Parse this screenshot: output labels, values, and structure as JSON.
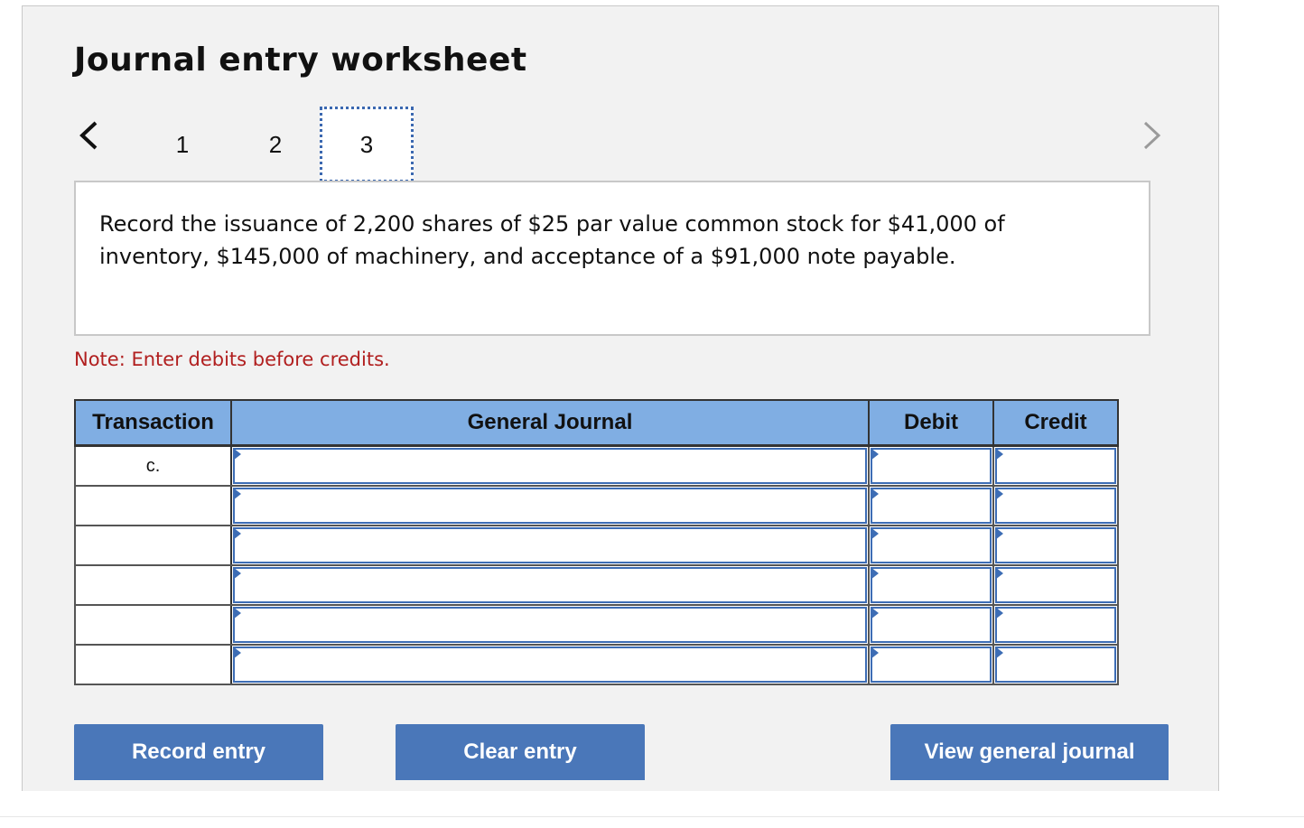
{
  "worksheet": {
    "title": "Journal entry worksheet",
    "steps": [
      "1",
      "2",
      "3"
    ],
    "active_step": "3",
    "prompt": "Record the issuance of 2,200 shares of $25 par value common stock for $41,000 of inventory, $145,000 of machinery, and acceptance of a $91,000 note payable.",
    "note": "Note: Enter debits before credits."
  },
  "table": {
    "headers": [
      "Transaction",
      "General Journal",
      "Debit",
      "Credit"
    ],
    "rows": [
      {
        "transaction": "c.",
        "account": "",
        "debit": "",
        "credit": ""
      },
      {
        "transaction": "",
        "account": "",
        "debit": "",
        "credit": ""
      },
      {
        "transaction": "",
        "account": "",
        "debit": "",
        "credit": ""
      },
      {
        "transaction": "",
        "account": "",
        "debit": "",
        "credit": ""
      },
      {
        "transaction": "",
        "account": "",
        "debit": "",
        "credit": ""
      },
      {
        "transaction": "",
        "account": "",
        "debit": "",
        "credit": ""
      }
    ]
  },
  "buttons": {
    "record": "Record entry",
    "clear": "Clear entry",
    "view": "View general journal"
  },
  "icons": {
    "prev": "chevron-left-icon",
    "next": "chevron-right-icon",
    "cell_marker": "triangle-right-icon"
  },
  "colors": {
    "header_bg": "#80aee3",
    "button_bg": "#4a77b9",
    "note_text": "#b11f1f",
    "input_border": "#3d6db5"
  }
}
